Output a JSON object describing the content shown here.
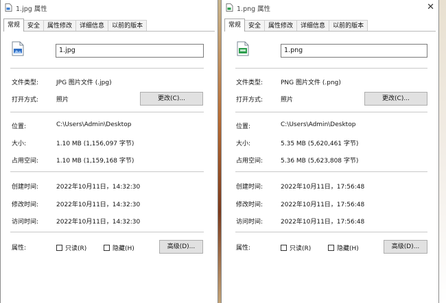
{
  "left": {
    "title": "1.jpg 属性",
    "tabs": [
      "常规",
      "安全",
      "属性修改",
      "详细信息",
      "以前的版本"
    ],
    "filename": "1.jpg",
    "file_type_label": "文件类型:",
    "file_type": "JPG 图片文件 (.jpg)",
    "open_with_label": "打开方式:",
    "open_with": "照片",
    "change_button": "更改(C)...",
    "location_label": "位置:",
    "location": "C:\\Users\\Admin\\Desktop",
    "size_label": "大小:",
    "size": "1.10 MB (1,156,097 字节)",
    "size_on_disk_label": "占用空间:",
    "size_on_disk": "1.10 MB (1,159,168 字节)",
    "created_label": "创建时间:",
    "created": "2022年10月11日，14:32:30",
    "modified_label": "修改时间:",
    "modified": "2022年10月11日，14:32:30",
    "accessed_label": "访问时间:",
    "accessed": "2022年10月11日，14:32:30",
    "attributes_label": "属性:",
    "readonly_label": "只读(R)",
    "hidden_label": "隐藏(H)",
    "advanced_button": "高级(D)..."
  },
  "right": {
    "title": "1.png 属性",
    "tabs": [
      "常规",
      "安全",
      "属性修改",
      "详细信息",
      "以前的版本"
    ],
    "filename": "1.png",
    "file_type_label": "文件类型:",
    "file_type": "PNG 图片文件 (.png)",
    "open_with_label": "打开方式:",
    "open_with": "照片",
    "change_button": "更改(C)...",
    "location_label": "位置:",
    "location": "C:\\Users\\Admin\\Desktop",
    "size_label": "大小:",
    "size": "5.35 MB (5,620,461 字节)",
    "size_on_disk_label": "占用空间:",
    "size_on_disk": "5.36 MB (5,623,808 字节)",
    "created_label": "创建时间:",
    "created": "2022年10月11日，17:56:48",
    "modified_label": "修改时间:",
    "modified": "2022年10月11日，17:56:48",
    "accessed_label": "访问时间:",
    "accessed": "2022年10月11日，17:56:48",
    "attributes_label": "属性:",
    "readonly_label": "只读(R)",
    "hidden_label": "隐藏(H)",
    "advanced_button": "高级(D)..."
  },
  "icons": {
    "left_file_icon": "image-file-icon",
    "right_file_icon": "image-file-icon",
    "close_icon": "close-icon"
  },
  "colors": {
    "button_bg": "#e1e1e1",
    "separator": "#c8c8c8",
    "png_icon_green": "#2e9e4f"
  }
}
